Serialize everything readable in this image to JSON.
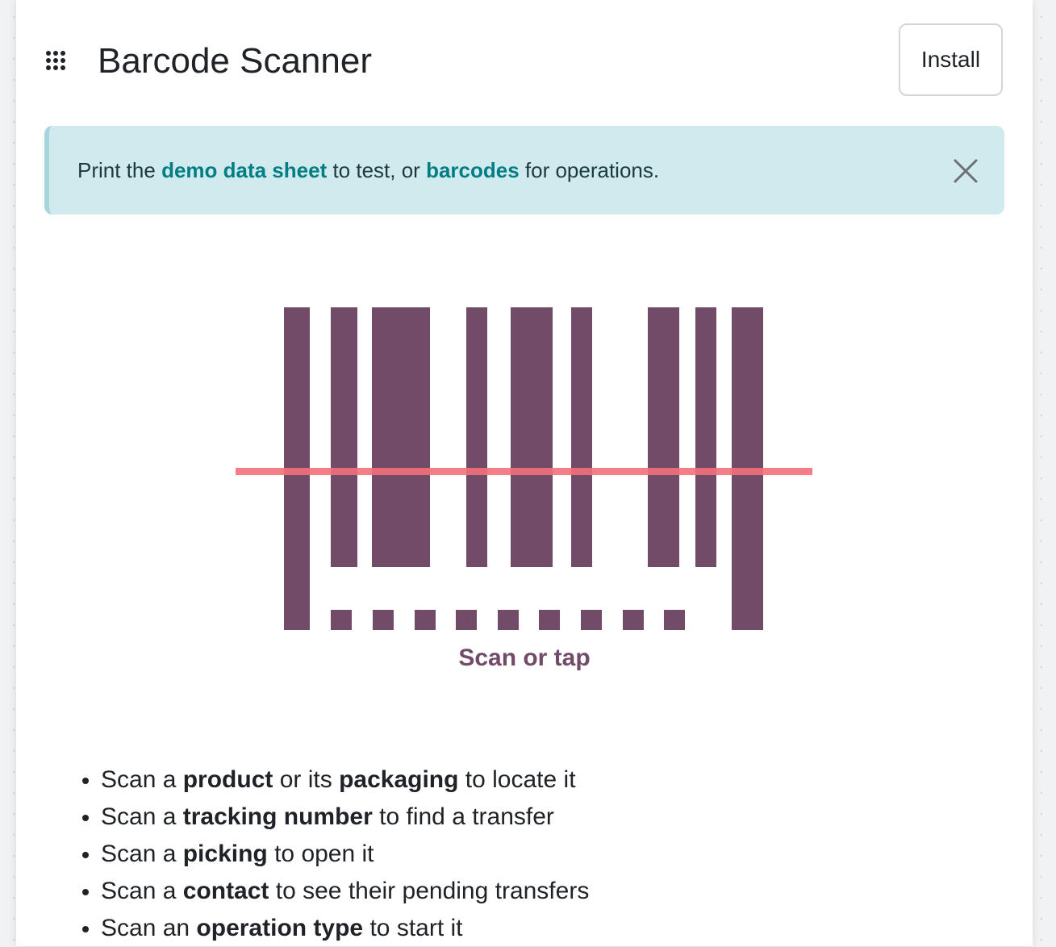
{
  "header": {
    "title": "Barcode Scanner",
    "install_label": "Install",
    "apps_icon": "grid-9-dots-icon"
  },
  "alert": {
    "text_1": "Print the ",
    "link_demo": "demo data sheet",
    "text_2": " to test, or ",
    "link_barcodes": "barcodes",
    "text_3": " for operations.",
    "close_icon": "close-icon",
    "colors": {
      "background": "#d0eaee",
      "link": "#017e84"
    }
  },
  "scanner": {
    "label": "Scan or tap",
    "illustration_icon": "barcode-scan-illustration",
    "colors": {
      "bars": "#714b67",
      "laser": "#f2707a"
    }
  },
  "instructions": [
    {
      "pre": "Scan a ",
      "b1": "product",
      "mid": " or its ",
      "b2": "packaging",
      "post": " to locate it"
    },
    {
      "pre": "Scan a ",
      "b1": "tracking number",
      "post": " to find a transfer"
    },
    {
      "pre": "Scan a ",
      "b1": "picking",
      "post": " to open it"
    },
    {
      "pre": "Scan a ",
      "b1": "contact",
      "post": " to see their pending transfers"
    },
    {
      "pre": "Scan an ",
      "b1": "operation type",
      "post": " to start it"
    }
  ]
}
